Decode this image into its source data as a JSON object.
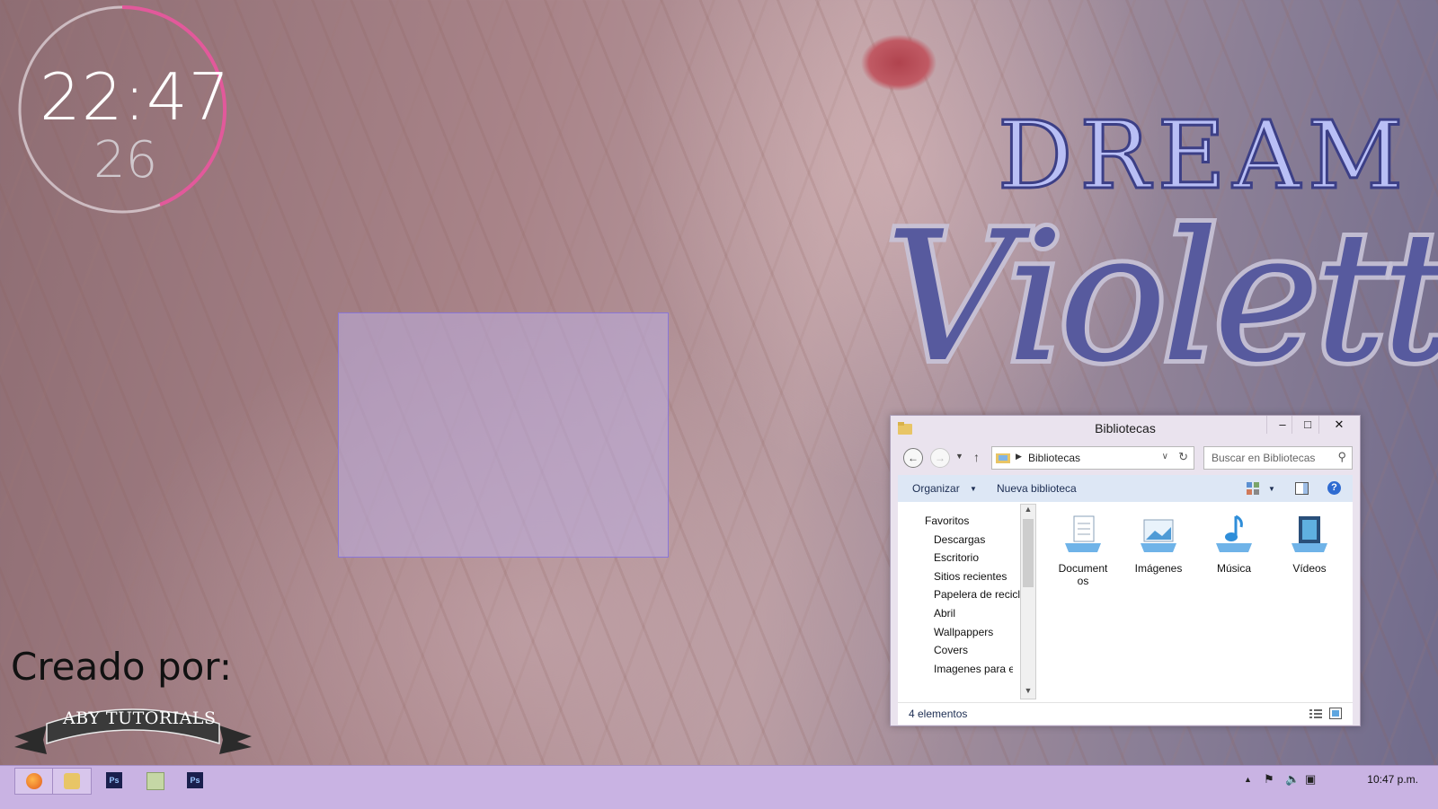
{
  "desktop": {
    "clock_time": "22:47",
    "clock_seconds": "26",
    "title_line1": "DREAM",
    "title_line2": "Violett",
    "credit_text": "Creado por:",
    "credit_ribbon": "ABY TUTORIALS",
    "colors": {
      "ring": "#e2599b",
      "title_fill": "#575a9e",
      "taskbar": "#c9b3e3"
    }
  },
  "explorer": {
    "title": "Bibliotecas",
    "buttons": {
      "minimize": "–",
      "maximize": "□",
      "close": "✕"
    },
    "address": "Bibliotecas",
    "search_placeholder": "Buscar en Bibliotecas",
    "commands": {
      "organize": "Organizar",
      "new_library": "Nueva biblioteca"
    },
    "tree": [
      {
        "label": "Favoritos",
        "icon": "star-icon"
      },
      {
        "label": "Descargas",
        "icon": "download-folder-icon"
      },
      {
        "label": "Escritorio",
        "icon": "desktop-icon"
      },
      {
        "label": "Sitios recientes",
        "icon": "recent-icon"
      },
      {
        "label": "Papelera de reciclaje",
        "icon": "recycle-bin-icon"
      },
      {
        "label": "Abril",
        "icon": "folder-icon"
      },
      {
        "label": "Wallpappers",
        "icon": "folder-icon"
      },
      {
        "label": "Covers",
        "icon": "folder-icon"
      },
      {
        "label": "Imagenes para edit",
        "icon": "folder-icon"
      }
    ],
    "libraries": [
      {
        "line1": "Document",
        "line2": "os",
        "icon": "documents-library-icon"
      },
      {
        "line1": "Imágenes",
        "line2": "",
        "icon": "pictures-library-icon"
      },
      {
        "line1": "Música",
        "line2": "",
        "icon": "music-library-icon"
      },
      {
        "line1": "Vídeos",
        "line2": "",
        "icon": "videos-library-icon"
      }
    ],
    "status": "4 elementos"
  },
  "taskbar": {
    "apps": [
      "firefox-icon",
      "file-explorer-icon",
      "photoshop-icon",
      "notepad-icon",
      "photoshop-icon"
    ],
    "time": "10:47 p.m."
  }
}
